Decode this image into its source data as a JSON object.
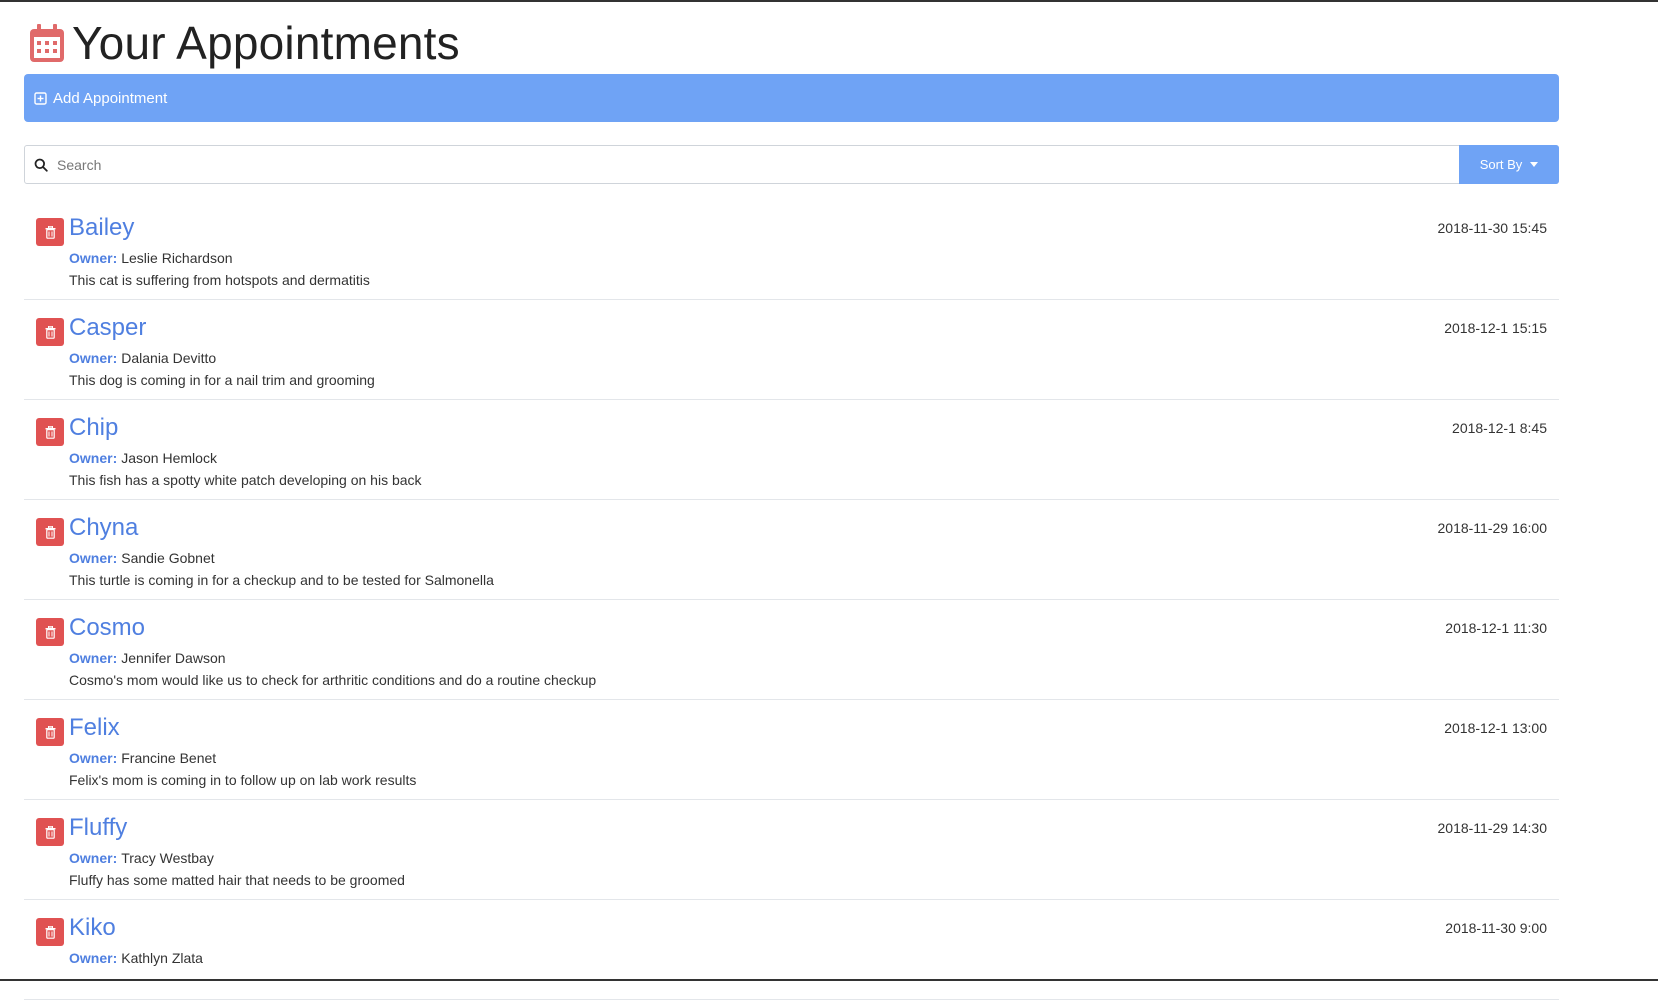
{
  "page": {
    "title": "Your Appointments",
    "add_label": "Add Appointment",
    "search_placeholder": "Search",
    "sort_label": "Sort By",
    "owner_label": "Owner:"
  },
  "colors": {
    "accent": "#6fa3f5",
    "link": "#4f7fe0",
    "danger": "#e05252",
    "calendar_icon": "#e06a6a"
  },
  "icons": {
    "header": "calendar-icon",
    "add": "plus-square-icon",
    "search": "search-icon",
    "sort": "caret-down-icon",
    "delete": "trash-icon"
  },
  "appointments": [
    {
      "pet": "Bailey",
      "owner": "Leslie Richardson",
      "notes": "This cat is suffering from hotspots and dermatitis",
      "date": "2018-11-30 15:45"
    },
    {
      "pet": "Casper",
      "owner": "Dalania Devitto",
      "notes": "This dog is coming in for a nail trim and grooming",
      "date": "2018-12-1 15:15"
    },
    {
      "pet": "Chip",
      "owner": "Jason Hemlock",
      "notes": "This fish has a spotty white patch developing on his back",
      "date": "2018-12-1 8:45"
    },
    {
      "pet": "Chyna",
      "owner": "Sandie Gobnet",
      "notes": "This turtle is coming in for a checkup and to be tested for Salmonella",
      "date": "2018-11-29 16:00"
    },
    {
      "pet": "Cosmo",
      "owner": "Jennifer Dawson",
      "notes": "Cosmo's mom would like us to check for arthritic conditions and do a routine checkup",
      "date": "2018-12-1 11:30"
    },
    {
      "pet": "Felix",
      "owner": "Francine Benet",
      "notes": "Felix's mom is coming in to follow up on lab work results",
      "date": "2018-12-1 13:00"
    },
    {
      "pet": "Fluffy",
      "owner": "Tracy Westbay",
      "notes": "Fluffy has some matted hair that needs to be groomed",
      "date": "2018-11-29 14:30"
    },
    {
      "pet": "Kiko",
      "owner": "Kathlyn Zlata",
      "notes": "",
      "date": "2018-11-30 9:00"
    }
  ]
}
